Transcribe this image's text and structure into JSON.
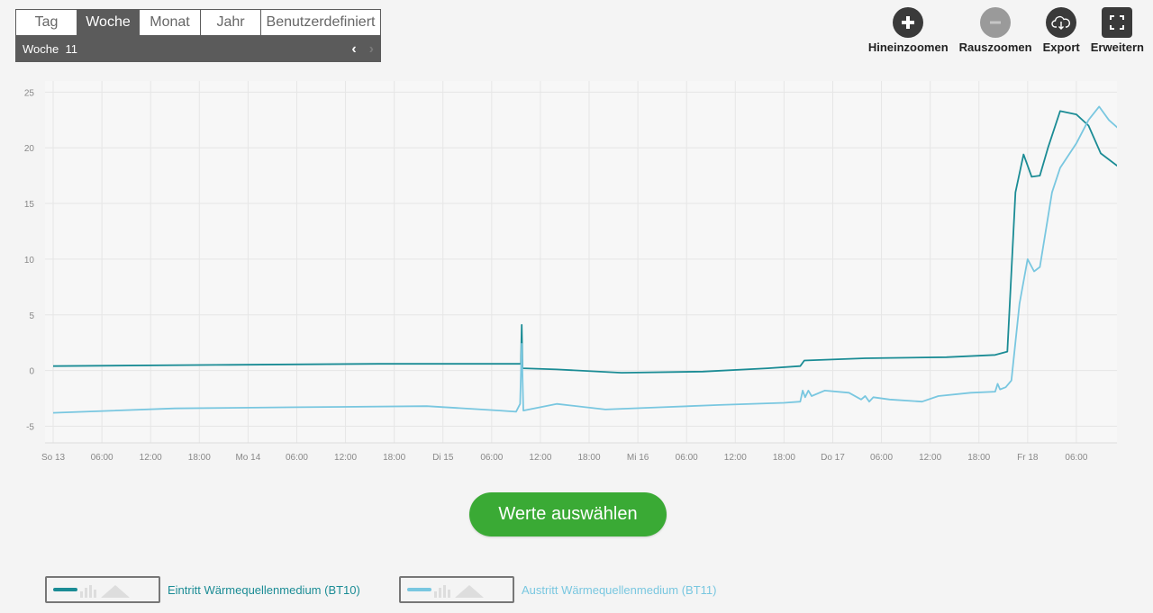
{
  "period": {
    "tabs": [
      "Tag",
      "Woche",
      "Monat",
      "Jahr",
      "Benutzerdefiniert"
    ],
    "active_tab": "Woche",
    "current": "Woche  11"
  },
  "toolbar": {
    "zoom_in": "Hineinzoomen",
    "zoom_out": "Rauszoomen",
    "export": "Export",
    "expand": "Erweitern"
  },
  "select_button": "Werte auswählen",
  "legend": [
    {
      "label": "Eintritt Wärmequellenmedium (BT10)",
      "color": "#1b8c95"
    },
    {
      "label": "Austritt Wärmequellenmedium (BT11)",
      "color": "#79c7e0"
    }
  ],
  "chart_data": {
    "type": "line",
    "x_unit": "hours since So 13 00:00",
    "x_tick_labels": [
      "So 13",
      "06:00",
      "12:00",
      "18:00",
      "Mo 14",
      "06:00",
      "12:00",
      "18:00",
      "Di 15",
      "06:00",
      "12:00",
      "18:00",
      "Mi 16",
      "06:00",
      "12:00",
      "18:00",
      "Do 17",
      "06:00",
      "12:00",
      "18:00",
      "Fr 18",
      "06:00"
    ],
    "xlim": [
      -1,
      131
    ],
    "ylim": [
      -6.5,
      26
    ],
    "y_ticks": [
      -5,
      0,
      5,
      10,
      15,
      20,
      25
    ],
    "grid": true,
    "series": [
      {
        "name": "Eintritt Wärmequellenmedium (BT10)",
        "color": "#1b8c95",
        "points": [
          [
            0,
            0.4
          ],
          [
            20,
            0.5
          ],
          [
            40,
            0.6
          ],
          [
            55,
            0.6
          ],
          [
            57.6,
            0.6
          ],
          [
            57.7,
            4.1
          ],
          [
            57.8,
            0.2
          ],
          [
            62,
            0.1
          ],
          [
            70,
            -0.2
          ],
          [
            80,
            -0.1
          ],
          [
            88,
            0.2
          ],
          [
            92,
            0.4
          ],
          [
            92.5,
            0.9
          ],
          [
            100,
            1.1
          ],
          [
            110,
            1.2
          ],
          [
            116,
            1.4
          ],
          [
            117.5,
            1.7
          ],
          [
            118.5,
            16
          ],
          [
            119.5,
            19.4
          ],
          [
            120.5,
            17.4
          ],
          [
            121.5,
            17.5
          ],
          [
            122.5,
            20
          ],
          [
            124,
            23.3
          ],
          [
            126,
            23
          ],
          [
            127.5,
            22
          ],
          [
            129,
            19.5
          ],
          [
            131,
            18.4
          ],
          [
            137,
            18.4
          ]
        ]
      },
      {
        "name": "Austritt Wärmequellenmedium (BT11)",
        "color": "#79c7e0",
        "points": [
          [
            0,
            -3.8
          ],
          [
            15,
            -3.4
          ],
          [
            30,
            -3.3
          ],
          [
            46,
            -3.2
          ],
          [
            55,
            -3.6
          ],
          [
            57,
            -3.7
          ],
          [
            57.5,
            -3
          ],
          [
            57.7,
            2.4
          ],
          [
            57.9,
            -3.6
          ],
          [
            62,
            -3
          ],
          [
            68,
            -3.5
          ],
          [
            75,
            -3.3
          ],
          [
            82,
            -3.1
          ],
          [
            90,
            -2.9
          ],
          [
            92,
            -2.8
          ],
          [
            92.3,
            -1.8
          ],
          [
            92.6,
            -2.4
          ],
          [
            93,
            -1.8
          ],
          [
            93.4,
            -2.3
          ],
          [
            95,
            -1.8
          ],
          [
            98,
            -2
          ],
          [
            99.5,
            -2.6
          ],
          [
            100,
            -2.3
          ],
          [
            100.5,
            -2.8
          ],
          [
            101,
            -2.4
          ],
          [
            103,
            -2.6
          ],
          [
            107,
            -2.8
          ],
          [
            109,
            -2.3
          ],
          [
            113,
            -2
          ],
          [
            116,
            -1.9
          ],
          [
            116.3,
            -1.2
          ],
          [
            116.6,
            -1.7
          ],
          [
            117.3,
            -1.5
          ],
          [
            118,
            -0.9
          ],
          [
            119,
            6
          ],
          [
            120,
            10
          ],
          [
            120.8,
            8.9
          ],
          [
            121.5,
            9.3
          ],
          [
            123,
            16
          ],
          [
            124,
            18.2
          ],
          [
            126,
            20.4
          ],
          [
            127.5,
            22.5
          ],
          [
            128.8,
            23.7
          ],
          [
            130,
            22.5
          ],
          [
            132,
            21.2
          ],
          [
            137,
            21.2
          ]
        ]
      }
    ]
  }
}
